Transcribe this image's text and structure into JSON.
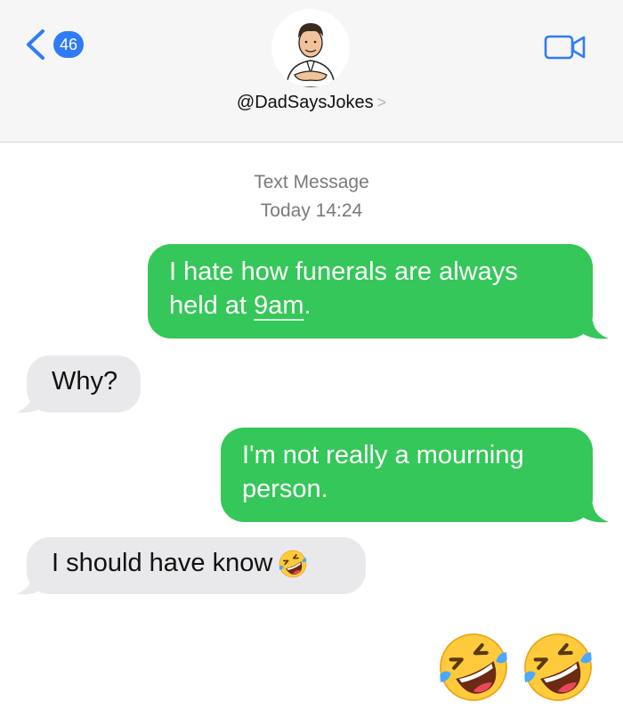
{
  "header": {
    "back_badge_count": "46",
    "contact_name": "@DadSaysJokes",
    "contact_chevron": ">"
  },
  "thread": {
    "meta_type": "Text Message",
    "meta_time": "Today 14:24"
  },
  "messages": [
    {
      "direction": "outgoing",
      "text_line1": "I hate how funerals are always",
      "text_line2_prefix": "held at ",
      "text_line2_link": "9am",
      "text_line2_suffix": "."
    },
    {
      "direction": "incoming",
      "text": "Why?"
    },
    {
      "direction": "outgoing",
      "text_line1": "I'm not really a mourning",
      "text_line2": "person."
    },
    {
      "direction": "incoming",
      "text": "I should have know",
      "emoji": "rolling-on-the-floor-laughing"
    }
  ],
  "trailing_emojis": [
    "rolling-on-the-floor-laughing",
    "rolling-on-the-floor-laughing"
  ],
  "colors": {
    "outgoing_bubble": "#35c759",
    "incoming_bubble": "#e9e9eb",
    "accent": "#2f7cf6"
  },
  "icons": {
    "back": "chevron-left-icon",
    "video": "video-camera-icon",
    "avatar": "avatar-illustration"
  }
}
